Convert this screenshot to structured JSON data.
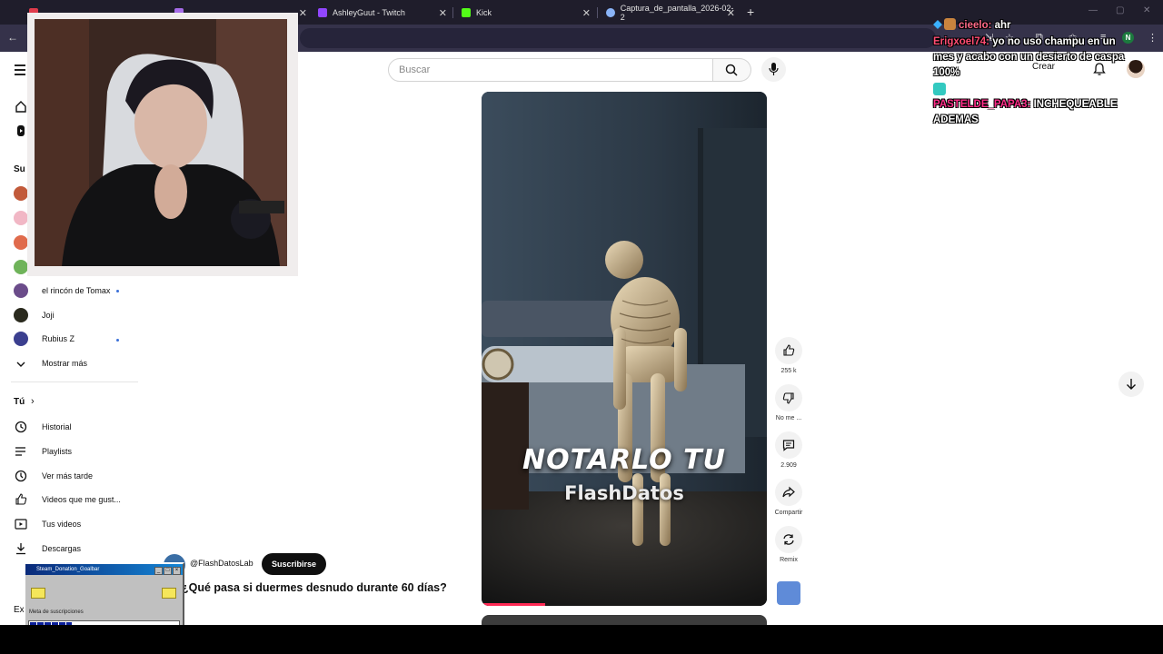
{
  "browser": {
    "tabs": [
      {
        "label": "",
        "color": "#e03b4b"
      },
      {
        "label": "",
        "color": "#a56be8"
      },
      {
        "label": "AshleyGuut - Twitch",
        "color": "#9146ff"
      },
      {
        "label": "Kick",
        "color": "#53fc18"
      },
      {
        "label": "Captura_de_pantalla_2026-02-2",
        "color": "#8ab4f8"
      }
    ],
    "new_tab": "+",
    "profile_initial": "N"
  },
  "youtube": {
    "search_placeholder": "Buscar",
    "create_label": "Crear",
    "sidebar": {
      "subscriptions_label": "Su",
      "subscriptions": [
        {
          "name": "el rincón de Tomax",
          "live": true,
          "color": "#6b4c8a"
        },
        {
          "name": "Joji",
          "live": false,
          "color": "#2a2a1e"
        },
        {
          "name": "Rubius Z",
          "live": true,
          "color": "#3b3f8f"
        }
      ],
      "show_more": "Mostrar más",
      "you_label": "Tú",
      "you_items": [
        {
          "label": "Historial",
          "icon": "history-icon"
        },
        {
          "label": "Playlists",
          "icon": "playlists-icon"
        },
        {
          "label": "Ver más tarde",
          "icon": "watch-later-icon"
        },
        {
          "label": "Videos que me gust...",
          "icon": "liked-icon"
        },
        {
          "label": "Tus videos",
          "icon": "your-videos-icon"
        },
        {
          "label": "Descargas",
          "icon": "downloads-icon"
        }
      ],
      "explore_label": "Ex"
    },
    "short": {
      "overlay_big": "NOTARLO TU",
      "overlay_small": "FlashDatos",
      "channel": "@FlashDatosLab",
      "subscribe_label": "Suscribirse",
      "title": "¿Qué pasa si duermes desnudo durante 60 días?",
      "actions": {
        "likes": "255 k",
        "dislike": "No me ...",
        "comments": "2.909",
        "share": "Compartir",
        "remix": "Remix"
      }
    }
  },
  "chat": [
    {
      "user": "cieelo:",
      "text": "ahr"
    },
    {
      "user": "Erigxoel74:",
      "text": "yo no uso champu en un mes y acabo con un desierto de caspa 100%"
    },
    {
      "user": "PASTELDE_PAPA3:",
      "text": "INCHEQUEABLE ADEMAS"
    }
  ],
  "donation": {
    "title": "Steam_Donation_Goalbar",
    "label": "Meta de suscripciones",
    "progress": 0.28
  }
}
